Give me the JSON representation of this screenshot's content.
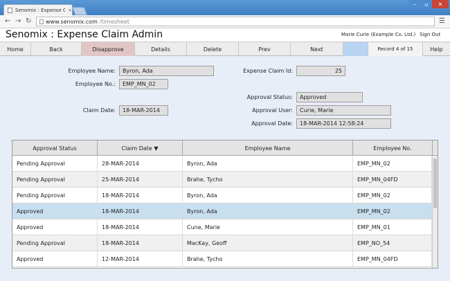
{
  "browser": {
    "tab_title": "Senomix : Expense Claim A",
    "tab_close": "×",
    "url_host": "www.senomix.com",
    "url_path": "/timesheet"
  },
  "app": {
    "title": "Senomix : Expense Claim Admin",
    "user": "Marie Curie  (Example Co. Ltd.)",
    "sign_out": "Sign Out"
  },
  "toolbar": {
    "home": "Home",
    "back": "Back",
    "disapprove": "Disapprove",
    "details": "Details",
    "delete": "Delete",
    "prev": "Prev",
    "next": "Next",
    "record": "Record 4 of 15",
    "help": "Help"
  },
  "form": {
    "employee_name_label": "Employee Name:",
    "employee_name": "Byron, Ada",
    "employee_no_label": "Employee No.:",
    "employee_no": "EMP_MN_02",
    "claim_date_label": "Claim Date:",
    "claim_date": "18-MAR-2014",
    "claim_id_label": "Expense Claim Id:",
    "claim_id": "25",
    "approval_status_label": "Approval Status:",
    "approval_status": "Approved",
    "approval_user_label": "Approval User:",
    "approval_user": "Curie, Marie",
    "approval_date_label": "Approval Date:",
    "approval_date": "18-MAR-2014 12:58:24"
  },
  "table": {
    "headers": [
      "Approval Status",
      "Claim Date ▼",
      "Employee Name",
      "Employee No."
    ],
    "rows": [
      [
        "Pending Approval",
        "28-MAR-2014",
        "Byron, Ada",
        "EMP_MN_02"
      ],
      [
        "Pending Approval",
        "25-MAR-2014",
        "Brahe, Tycho",
        "EMP_MN_04FD"
      ],
      [
        "Pending Approval",
        "18-MAR-2014",
        "Byron, Ada",
        "EMP_MN_02"
      ],
      [
        "Approved",
        "18-MAR-2014",
        "Byron, Ada",
        "EMP_MN_02"
      ],
      [
        "Approved",
        "18-MAR-2014",
        "Cune, Marie",
        "EMP_MN_01"
      ],
      [
        "Pending Approval",
        "18-MAR-2014",
        "MacKay, Geoff",
        "EMP_NO_54"
      ],
      [
        "Approved",
        "12-MAR-2014",
        "Brahe, Tycho",
        "EMP_MN_04FD"
      ]
    ]
  },
  "colors": {
    "content_bg": "#e8eef8",
    "selected_row": "#c8dff0",
    "disapprove_bg": "#e2c6c6",
    "blank_button_bg": "#b9d3f3"
  }
}
